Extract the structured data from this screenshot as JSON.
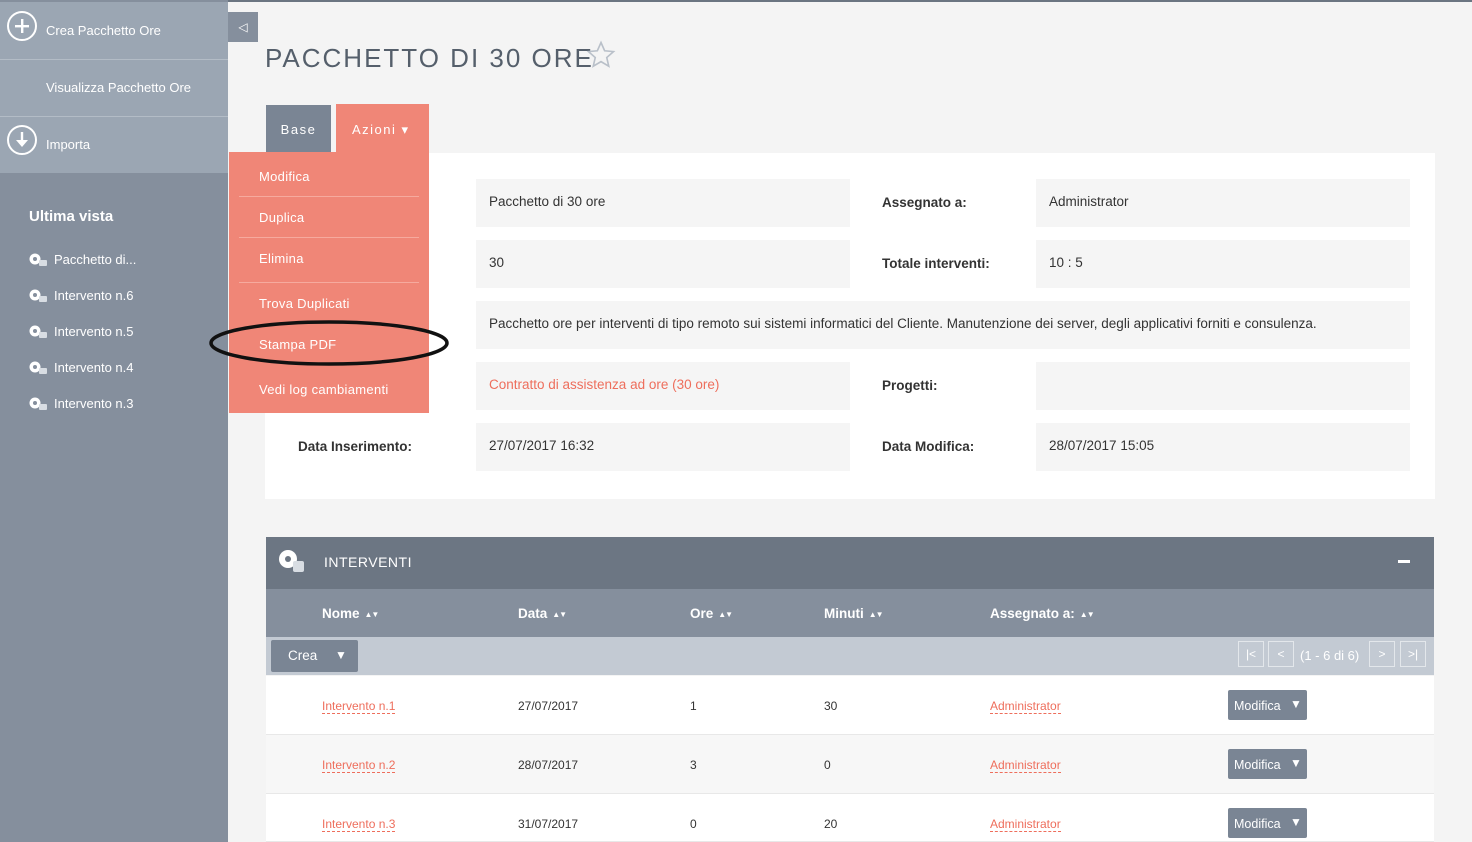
{
  "sidebar": {
    "actions": [
      {
        "label": "Crea Pacchetto Ore",
        "icon": "plus-circle-icon"
      },
      {
        "label": "Visualizza Pacchetto Ore"
      },
      {
        "label": "Importa",
        "icon": "download-circle-icon"
      }
    ],
    "recent_heading": "Ultima vista",
    "recent_items": [
      "Pacchetto di...",
      "Intervento n.6",
      "Intervento n.5",
      "Intervento n.4",
      "Intervento n.3"
    ]
  },
  "collapse_icon": "◁",
  "title": "PACCHETTO DI 30 ORE",
  "tabs": {
    "base": "Base",
    "azioni": "Azioni ▾"
  },
  "menu": {
    "items": [
      "Modifica",
      "Duplica",
      "Elimina",
      "Trova Duplicati",
      "Stampa PDF",
      "Vedi log cambiamenti"
    ],
    "highlighted": "Stampa PDF"
  },
  "detail": {
    "name_value": "Pacchetto di 30 ore",
    "assegnato_label": "Assegnato a:",
    "assegnato_value": "Administrator",
    "ore_value": "30",
    "totale_label": "Totale interventi:",
    "totale_value": "10 : 5",
    "descrizione_value": "Pacchetto ore per interventi di tipo remoto sui sistemi informatici del Cliente. Manutenzione dei server, degli applicativi forniti e consulenza.",
    "contratto_value": "Contratto di assistenza ad ore (30 ore)",
    "progetti_label": "Progetti:",
    "progetti_value": "",
    "data_ins_label": "Data Inserimento:",
    "data_ins_value": "27/07/2017 16:32",
    "data_mod_label": "Data Modifica:",
    "data_mod_value": "28/07/2017 15:05"
  },
  "subpanel": {
    "title": "INTERVENTI",
    "columns": [
      "Nome",
      "Data",
      "Ore",
      "Minuti",
      "Assegnato a:"
    ],
    "crea_label": "Crea",
    "pagination": {
      "first": "|<",
      "prev": "<",
      "text": "(1 - 6 di 6)",
      "next": ">",
      "last": ">|"
    },
    "edit_label": "Modifica",
    "rows": [
      {
        "nome": "Intervento n.1",
        "data": "27/07/2017",
        "ore": "1",
        "minuti": "30",
        "assegnato": "Administrator"
      },
      {
        "nome": "Intervento n.2",
        "data": "28/07/2017",
        "ore": "3",
        "minuti": "0",
        "assegnato": "Administrator"
      },
      {
        "nome": "Intervento n.3",
        "data": "31/07/2017",
        "ore": "0",
        "minuti": "20",
        "assegnato": "Administrator"
      }
    ]
  },
  "colors": {
    "accent": "#f08677",
    "sidebar": "#858f9d",
    "link": "#ee6e5c"
  }
}
